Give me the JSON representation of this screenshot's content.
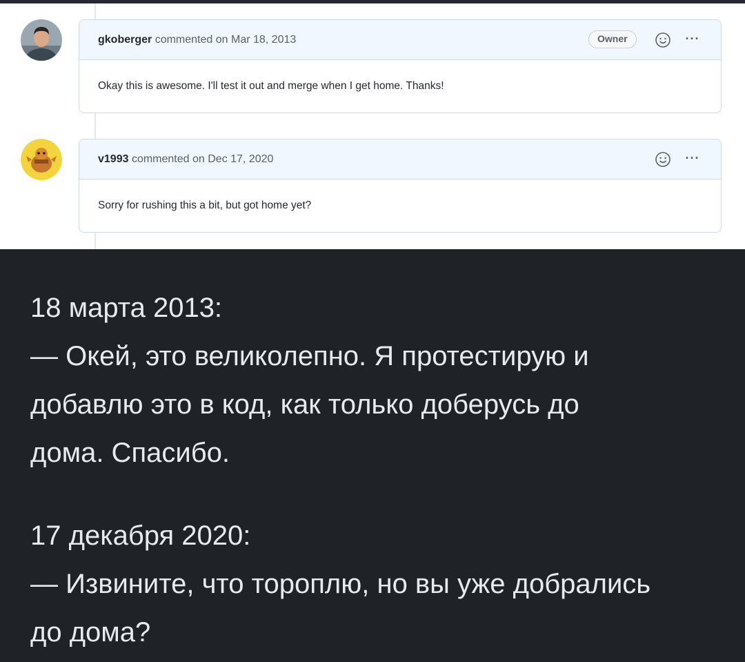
{
  "comments": [
    {
      "author": "gkoberger",
      "meta": "commented on Mar 18, 2013",
      "badge": "Owner",
      "body": "Okay this is awesome. I'll test it out and merge when I get home. Thanks!",
      "react_icon": "smiley-icon",
      "more_icon": "kebab-horizontal-icon"
    },
    {
      "author": "v1993",
      "meta": "commented on Dec 17, 2020",
      "body": "Sorry for rushing this a bit, but got home yet?",
      "react_icon": "smiley-icon",
      "more_icon": "kebab-horizontal-icon"
    }
  ],
  "more_glyph": "···",
  "translation": {
    "block1": {
      "date": "18 марта 2013:",
      "lines": [
        "— Окей, это великолепно. Я протестирую и",
        "добавлю это в код, как только доберусь до",
        "дома. Спасибо."
      ]
    },
    "block2": {
      "date": "17 декабря 2020:",
      "lines": [
        "— Извините, что тороплю, но вы уже добрались",
        "до дома?"
      ]
    }
  },
  "colors": {
    "header_bg": "#f1f7ff",
    "border": "#cdd9e8",
    "dark_bg": "#1f2328",
    "text_light": "#e8eaed"
  }
}
